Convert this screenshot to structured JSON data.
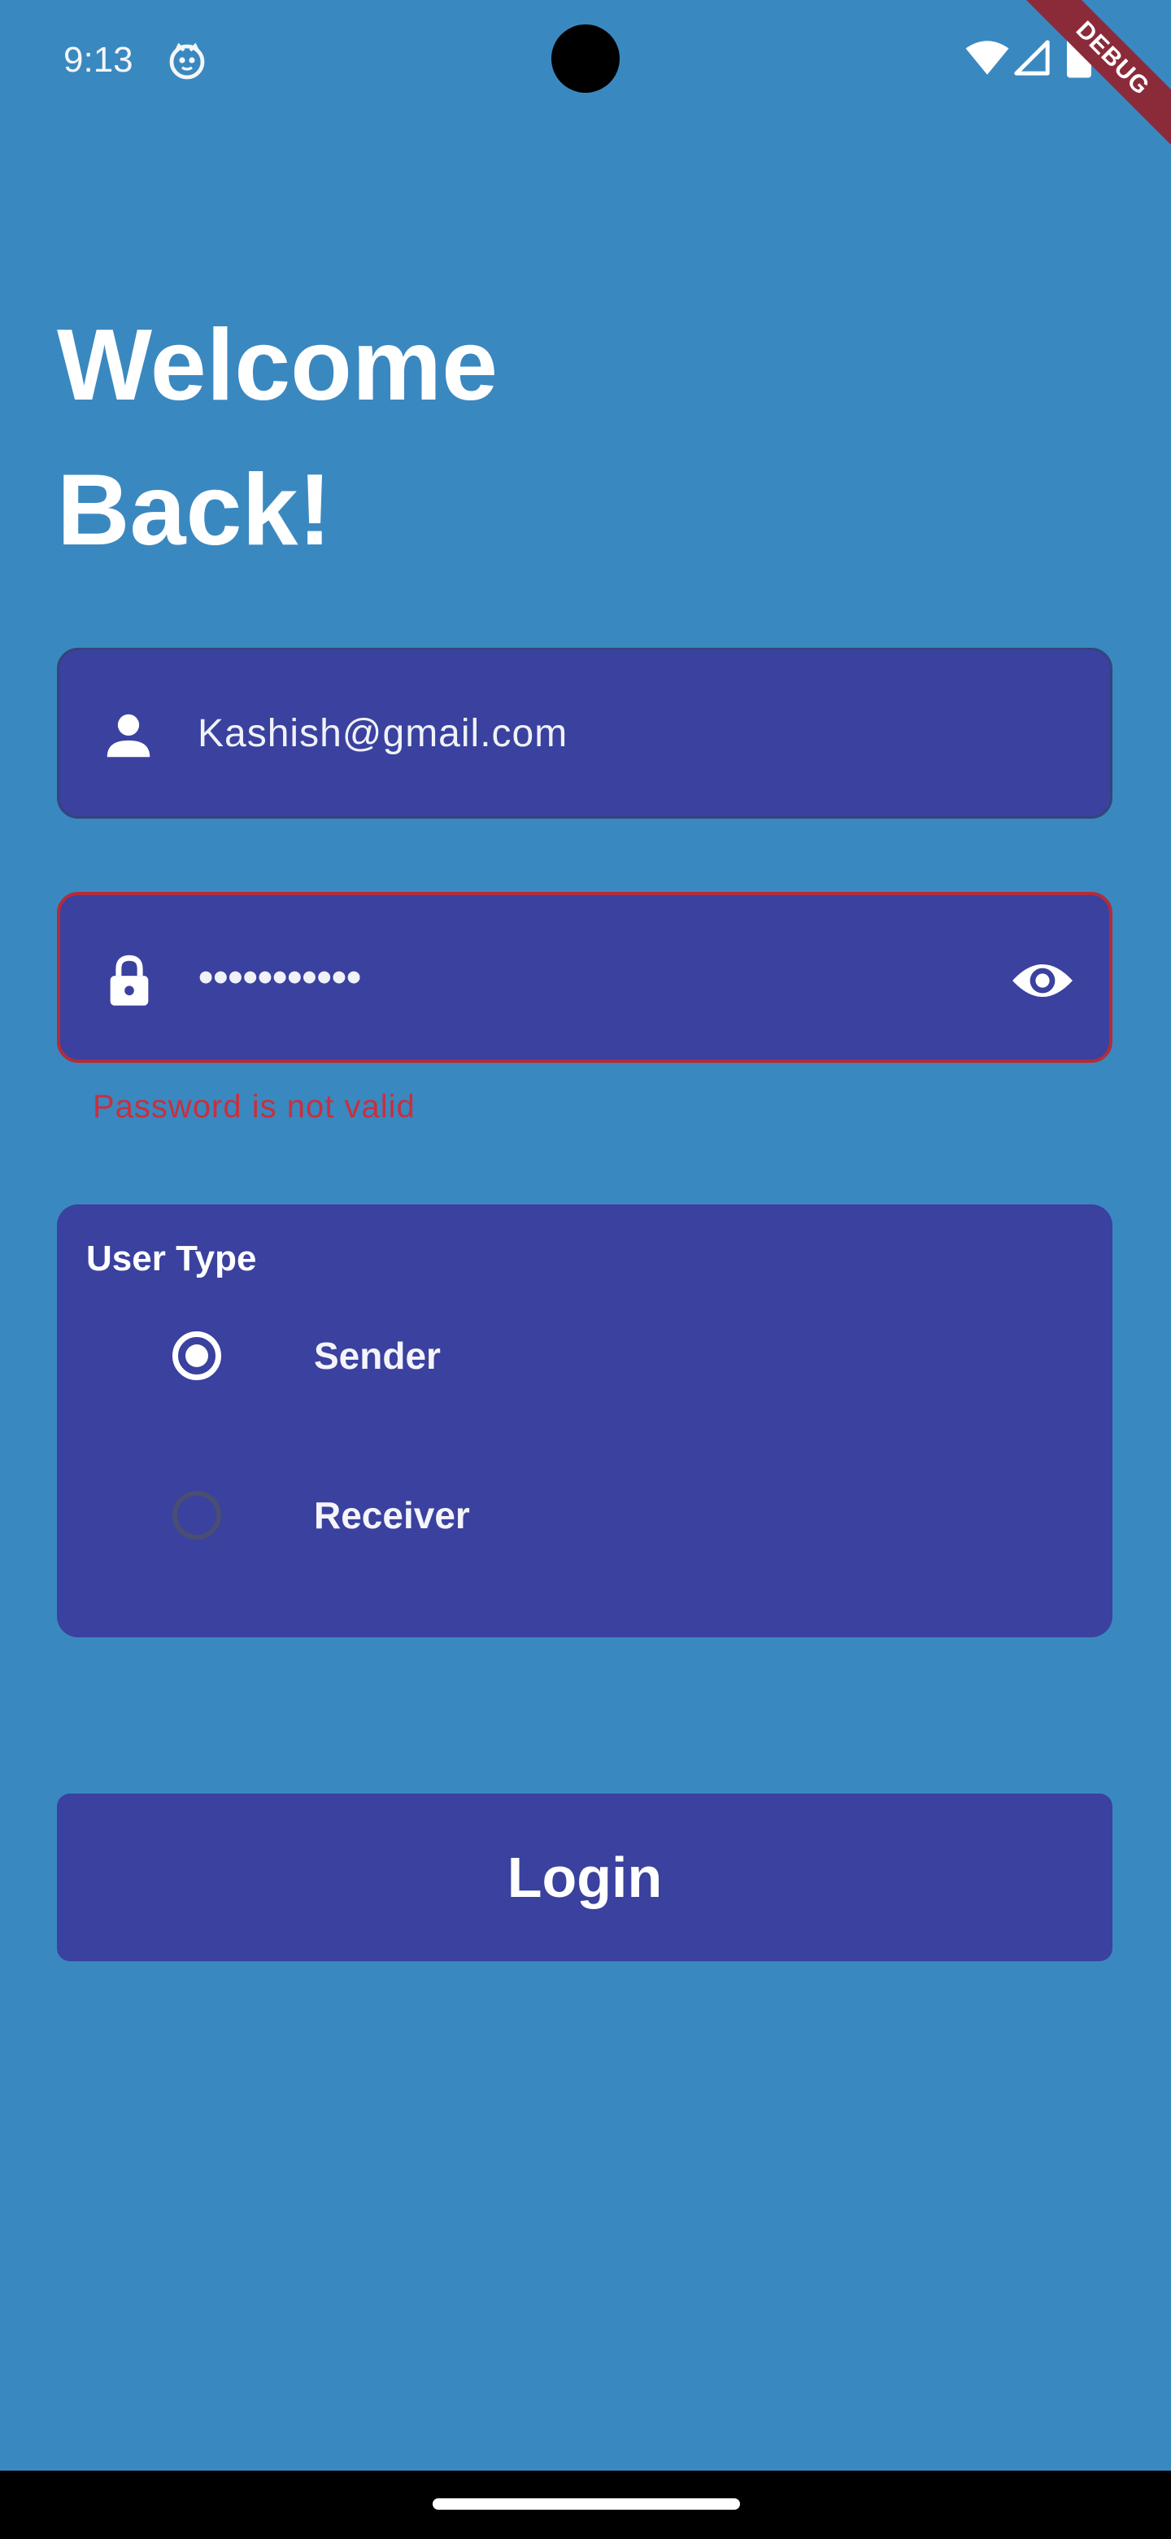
{
  "status_bar": {
    "time": "9:13",
    "icons": [
      "app-notification-icon",
      "wifi-icon",
      "signal-icon",
      "battery-icon"
    ]
  },
  "debug_banner": "DEBUG",
  "title": {
    "line1": "Welcome",
    "line2": "Back!"
  },
  "email_field": {
    "icon": "person-icon",
    "value": "Kashish@gmail.com"
  },
  "password_field": {
    "icon": "lock-icon",
    "value": "•••••••••••",
    "toggle_icon": "eye-icon",
    "error": "Password is not valid"
  },
  "user_type": {
    "label": "User Type",
    "options": [
      {
        "label": "Sender",
        "selected": true
      },
      {
        "label": "Receiver",
        "selected": false
      }
    ]
  },
  "login_button": {
    "label": "Login"
  },
  "colors": {
    "background": "#3a88c0",
    "card": "#3a419e",
    "error": "#c7303d",
    "debug_ribbon": "#8b2b3a"
  }
}
